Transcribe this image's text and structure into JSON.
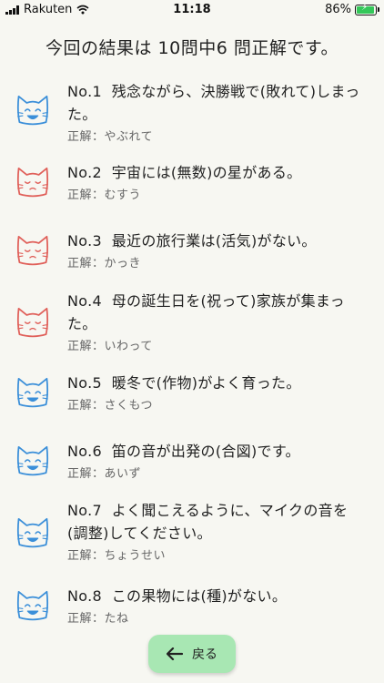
{
  "status": {
    "carrier": "Rakuten",
    "time": "11:18",
    "battery": "86%",
    "battery_level": 0.86
  },
  "result_title": "今回の結果は  10問中6 問正解です。",
  "items": [
    {
      "no": "No.1",
      "text": "残念ながら、決勝戦で(敗れて)しまった。",
      "answer": "正解：やぶれて",
      "correct": true
    },
    {
      "no": "No.2",
      "text": "宇宙には(無数)の星がある。",
      "answer": "正解：むすう",
      "correct": false
    },
    {
      "no": "No.3",
      "text": "最近の旅行業は(活気)がない。",
      "answer": "正解：かっき",
      "correct": false
    },
    {
      "no": "No.4",
      "text": "母の誕生日を(祝って)家族が集まった。",
      "answer": "正解：いわって",
      "correct": false
    },
    {
      "no": "No.5",
      "text": "暖冬で(作物)がよく育った。",
      "answer": "正解：さくもつ",
      "correct": true
    },
    {
      "no": "No.6",
      "text": "笛の音が出発の(合図)です。",
      "answer": "正解：あいず",
      "correct": true
    },
    {
      "no": "No.7",
      "text": "よく聞こえるように、マイクの音を(調整)してください。",
      "answer": "正解：ちょうせい",
      "correct": true
    },
    {
      "no": "No.8",
      "text": "この果物には(種)がない。",
      "answer": "正解：たね",
      "correct": true
    }
  ],
  "icons": {
    "correct": "happy-cat-icon",
    "wrong": "sleeping-cat-icon",
    "back": "arrow-left-icon"
  },
  "colors": {
    "correct": "#3b8fd9",
    "wrong": "#e0605a",
    "button": "#a8e7b3"
  },
  "back_button": {
    "label": "戻る"
  }
}
